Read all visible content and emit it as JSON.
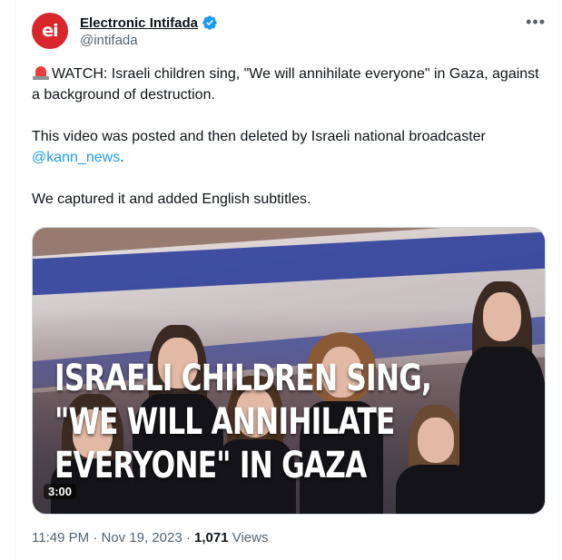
{
  "author": {
    "avatar_text": "ei",
    "display_name": "Electronic Intifada",
    "handle": "@intifada"
  },
  "menu": {
    "more_label": "•••"
  },
  "tweet": {
    "line1": "WATCH: Israeli children sing, \"We will annihilate everyone\" in Gaza, against a background of destruction.",
    "line2_prefix": "This video was posted and then deleted by Israeli national broadcaster",
    "mention": "@kann_news",
    "line2_suffix": ".",
    "line3": "We captured it and added English subtitles."
  },
  "media": {
    "overlay_line1": "ISRAELI CHILDREN SING,",
    "overlay_line2": "\"WE WILL ANNIHILATE",
    "overlay_line3": "EVERYONE\" IN GAZA",
    "duration": "3:00"
  },
  "footer": {
    "time": "11:49 PM",
    "date": "Nov 19, 2023",
    "views_count": "1,071",
    "views_label": "Views",
    "separator": "·"
  },
  "colors": {
    "link": "#1d9bf0",
    "verified": "#1d9bf0",
    "avatar_bg": "#d9262b",
    "muted": "#536471"
  }
}
